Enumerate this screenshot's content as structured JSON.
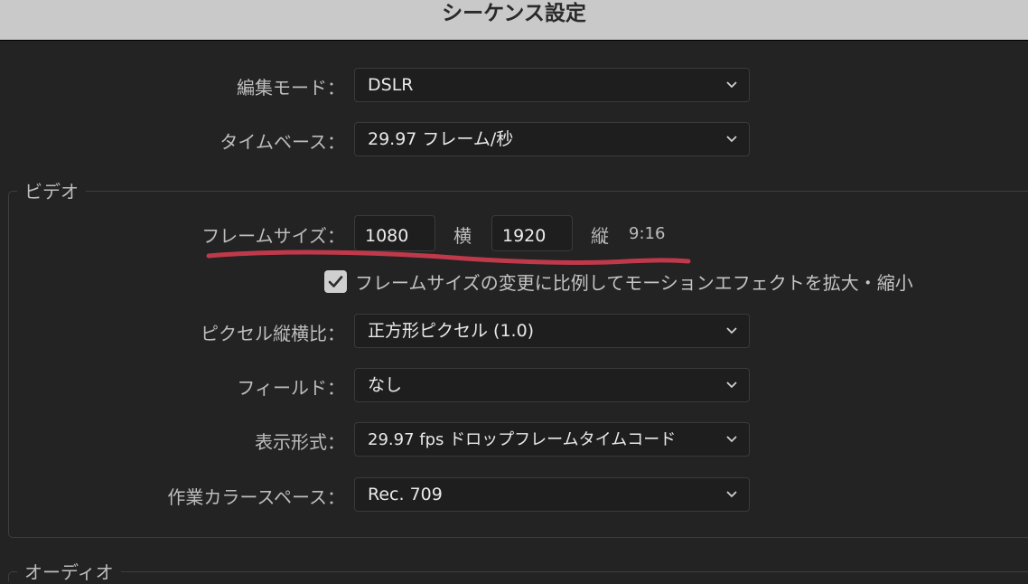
{
  "window": {
    "title": "シーケンス設定"
  },
  "edit_mode": {
    "label": "編集モード：",
    "value": "DSLR"
  },
  "timebase": {
    "label": "タイムベース：",
    "value": "29.97  フレーム/秒"
  },
  "video_section": {
    "title": "ビデオ",
    "frame_size": {
      "label": "フレームサイズ：",
      "width": "1080",
      "horizontal_label": "横",
      "height": "1920",
      "vertical_label": "縦",
      "aspect": "9:16"
    },
    "scale_checkbox": {
      "label": "フレームサイズの変更に比例してモーションエフェクトを拡大・縮小",
      "checked": true
    },
    "pixel_aspect": {
      "label": "ピクセル縦横比：",
      "value": "正方形ピクセル (1.0)"
    },
    "fields": {
      "label": "フィールド：",
      "value": "なし"
    },
    "display_format": {
      "label": "表示形式：",
      "value": "29.97 fps ドロップフレームタイムコード"
    },
    "working_color_space": {
      "label": "作業カラースペース：",
      "value": "Rec. 709"
    }
  },
  "audio_section": {
    "title": "オーディオ"
  },
  "colors": {
    "annotation_stroke": "#c0394b",
    "background": "#232323",
    "titlebar": "#c9c9c9"
  }
}
